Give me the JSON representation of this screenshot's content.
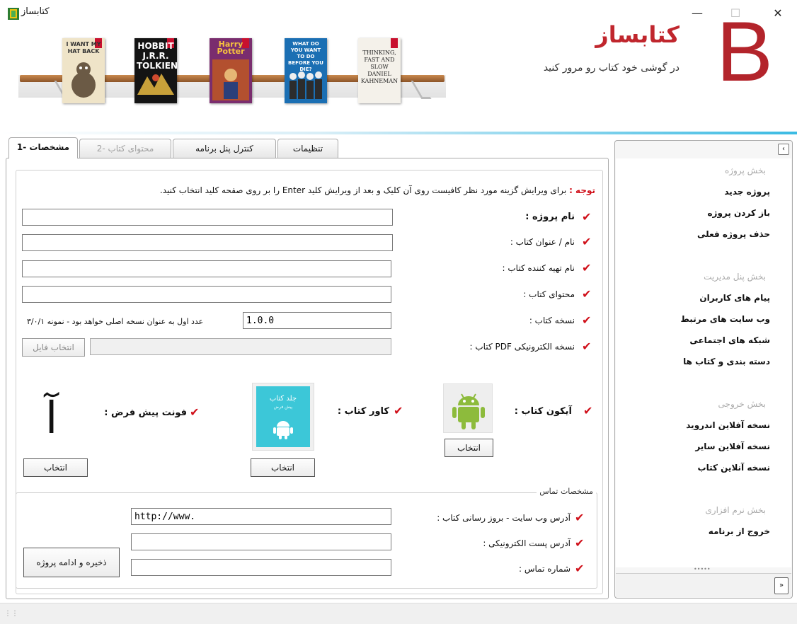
{
  "window": {
    "title": "کتابساز",
    "minimize": "—",
    "maximize": "☐",
    "close": "✕"
  },
  "banner": {
    "brand_letter": "B",
    "brand_name": "کتابساز",
    "tagline": "در گوشی خود کتاب رو مرور کنید",
    "books": [
      {
        "cover_text": "I WANT MY HAT BACK",
        "color": "#efe4c8",
        "text_color": "#333"
      },
      {
        "cover_text": "HOBBIT J.R.R. TOLKIEN",
        "color": "#141414",
        "text_color": "#fff"
      },
      {
        "cover_text": "Harry Potter",
        "color": "#7a2d6e",
        "text_color": "#f6c23e"
      },
      {
        "cover_text": "WHAT DO YOU WANT TO DO BEFORE YOU DIE?",
        "color": "#1b6fb3",
        "text_color": "#fff"
      },
      {
        "cover_text": "THINKING, FAST AND SLOW DANIEL KAHNEMAN",
        "color": "#f4f1ea",
        "text_color": "#222"
      }
    ]
  },
  "tabs": [
    {
      "label": "مشخصات -1",
      "state": "active"
    },
    {
      "label": "محتوای کتاب -2",
      "state": "disabled"
    },
    {
      "label": "کنترل پنل برنامه",
      "state": "normal"
    },
    {
      "label": "تنظیمات",
      "state": "normal"
    }
  ],
  "note": {
    "label": "توجه :",
    "text": "برای ویرایش گزینه مورد نظر کافیست روی آن کلیک و بعد از ویرایش کلید Enter را بر روی صفحه کلید انتخاب کنید."
  },
  "form": {
    "project_name": {
      "label": "نام پروژه :",
      "value": ""
    },
    "book_title": {
      "label": "نام / عنوان کتاب :",
      "value": ""
    },
    "author": {
      "label": "نام تهیه کننده کتاب :",
      "value": ""
    },
    "content": {
      "label": "محتوای کتاب :",
      "value": ""
    },
    "version": {
      "label": "نسخه کتاب :",
      "value": "1.0.0",
      "hint": "عدد اول به عنوان نسخه اصلی خواهد بود - نمونه ۳/۰/۱"
    },
    "pdf": {
      "label": "نسخه الکترونیکی PDF کتاب :",
      "value": "",
      "button": "انتخاب فایل"
    },
    "book_icon": {
      "label": "آیکون کتاب :",
      "button": "انتخاب"
    },
    "book_cover": {
      "label": "کاور کتاب :",
      "button": "انتخاب",
      "cover_title": "جلد کتاب",
      "cover_subtitle": "پیش فرض"
    },
    "default_font": {
      "label": "فونت پیش فرض :",
      "button": "انتخاب",
      "sample": "آ"
    }
  },
  "contact": {
    "legend": "مشخصات تماس",
    "website": {
      "label": "آدرس وب سایت - بروز رسانی کتاب :",
      "value": "http://www."
    },
    "email": {
      "label": "آدرس پست الکترونیکی :",
      "value": ""
    },
    "phone": {
      "label": "شماره تماس :",
      "value": ""
    },
    "save_button": "ذخیره و ادامه پروژه"
  },
  "sidebar": {
    "collapse": "‹",
    "expand": "»",
    "grip": "•••••",
    "sections": [
      {
        "title": "بخش پروژه",
        "items": [
          "پروژه جدید",
          "باز کردن پروژه",
          "حذف پروژه فعلی"
        ]
      },
      {
        "title": "بخش پنل مدیریت",
        "items": [
          "پیام های کاربران",
          "وب سایت های مرتبط",
          "شبکه های اجتماعی",
          "دسته بندی و کتاب ها"
        ]
      },
      {
        "title": "بخش خروجی",
        "items": [
          "نسخه آفلاین اندروید",
          "نسخه آفلاین سایر",
          "نسخه آنلاین کتاب"
        ]
      },
      {
        "title": "بخش نرم افزاری",
        "items": [
          "خروج از برنامه"
        ]
      }
    ]
  },
  "colors": {
    "accent_red": "#d0101a",
    "brand_red": "#b3242b",
    "android_green": "#8dbb3c",
    "cover_teal": "#3cc7d8"
  },
  "statusbar": {
    "grip": "⋮⋮"
  }
}
